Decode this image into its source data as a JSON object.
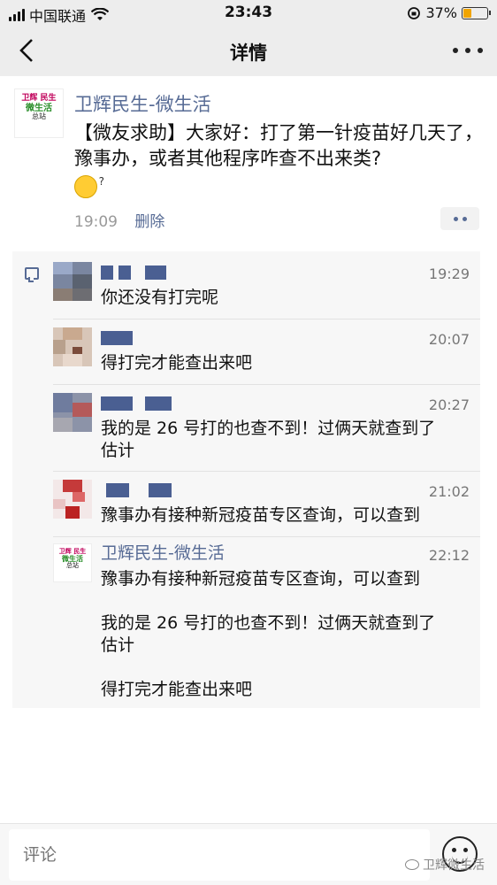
{
  "status_bar": {
    "carrier": "中国联通",
    "time": "23:43",
    "battery": "37%",
    "battery_level": 0.37
  },
  "nav": {
    "title": "详情"
  },
  "post": {
    "author": "卫辉民生-微生活",
    "logo": {
      "line1": "卫辉 民生",
      "line2": "微生活",
      "line3": "总站"
    },
    "text": "【微友求助】大家好：打了第一针疫苗好几天了，豫事办，或者其他程序咋查不出来类?",
    "time": "19:09",
    "delete_label": "删除"
  },
  "comments": [
    {
      "time": "19:29",
      "text": "你还没有打完呢"
    },
    {
      "time": "20:07",
      "text": "得打完才能查出来吧"
    },
    {
      "time": "20:27",
      "text": "我的是 26 号打的也查不到！过俩天就查到了\n估计"
    },
    {
      "time": "21:02",
      "text": "豫事办有接种新冠疫苗专区查询，可以查到"
    },
    {
      "author": "卫辉民生-微生活",
      "time": "22:12",
      "text": "豫事办有接种新冠疫苗专区查询，可以查到\n\n我的是 26 号打的也查不到！过俩天就查到了\n估计\n\n得打完才能查出来吧"
    }
  ],
  "bottom": {
    "comment_placeholder": "评论",
    "watermark": "卫辉微生活"
  }
}
